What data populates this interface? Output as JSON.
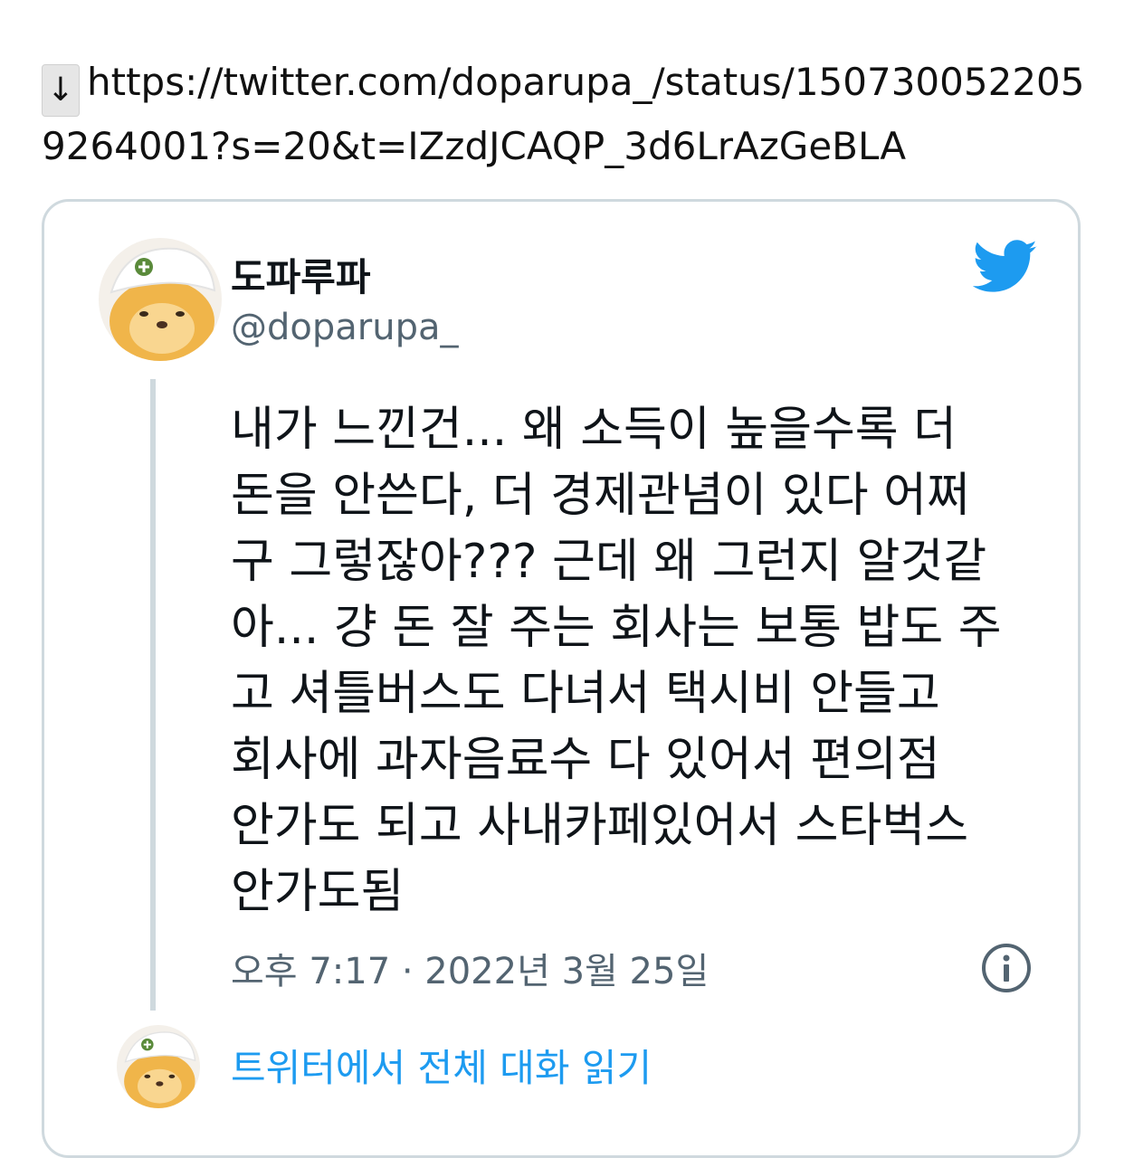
{
  "link": {
    "arrow": "↓",
    "url": "https://twitter.com/doparupa_/status/1507300522059264001?s=20&t=IZzdJCAQP_3d6LrAzGeBLA"
  },
  "tweet": {
    "display_name": "도파루파",
    "handle": "@doparupa_",
    "text": "내가 느낀건... 왜 소득이 높을수록 더\n돈을 안쓴다, 더 경제관념이 있다 어쩌\n구 그렇잖아??? 근데 왜 그런지 알것같\n아... 걍 돈 잘 주는 회사는 보통 밥도 주\n고 셔틀버스도 다녀서 택시비 안들고\n회사에 과자음료수 다 있어서 편의점\n안가도 되고 사내카페있어서 스타벅스\n안가도됨",
    "timestamp": "오후 7:17 · 2022년 3월 25일",
    "read_conversation": "트위터에서 전체 대화 읽기"
  },
  "icons": {
    "download": "down-arrow-icon",
    "brand": "twitter-bird-icon",
    "info": "info-icon",
    "avatar": "lion-character-avatar"
  },
  "colors": {
    "twitter_blue": "#1d9bf0",
    "secondary_text": "#536471",
    "border": "#cfd9de"
  }
}
